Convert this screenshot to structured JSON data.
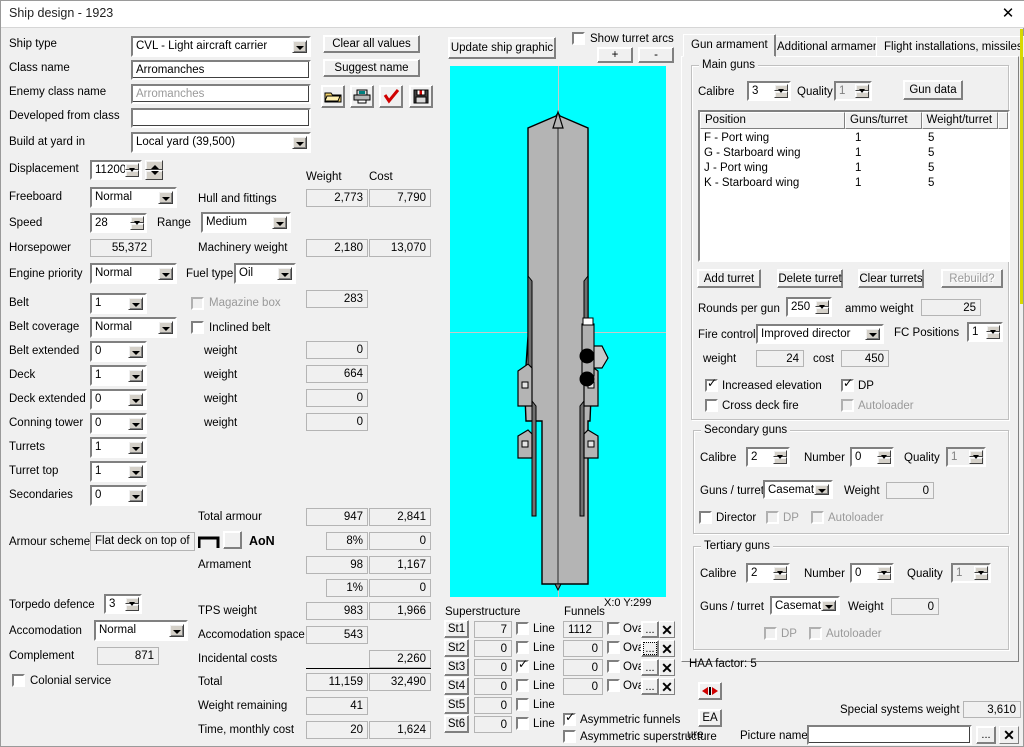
{
  "window": {
    "title": "Ship design - 1923",
    "close_label": "✕"
  },
  "left": {
    "ship_type_label": "Ship type",
    "ship_type_value": "CVL - Light aircraft carrier",
    "class_name_label": "Class name",
    "class_name_value": "Arromanches",
    "enemy_class_label": "Enemy class name",
    "enemy_class_value": "Arromanches",
    "developed_from_label": "Developed from class",
    "developed_from_value": "",
    "build_yard_label": "Build at yard in",
    "build_yard_value": "Local yard (39,500)",
    "displacement_label": "Displacement",
    "displacement_value": "11200",
    "freeboard_label": "Freeboard",
    "freeboard_value": "Normal",
    "speed_label": "Speed",
    "speed_value": "28",
    "range_label": "Range",
    "range_value": "Medium",
    "horsepower_label": "Horsepower",
    "horsepower_value": "55,372",
    "engine_priority_label": "Engine priority",
    "engine_priority_value": "Normal",
    "fuel_type_label": "Fuel type",
    "fuel_type_value": "Oil",
    "belt_label": "Belt",
    "belt_value": "1",
    "belt_coverage_label": "Belt coverage",
    "belt_coverage_value": "Normal",
    "belt_extended_label": "Belt extended",
    "belt_extended_value": "0",
    "deck_label": "Deck",
    "deck_value": "1",
    "deck_extended_label": "Deck extended",
    "deck_extended_value": "0",
    "conning_tower_label": "Conning tower",
    "conning_tower_value": "0",
    "turrets_label": "Turrets",
    "turrets_value": "1",
    "turret_top_label": "Turret top",
    "turret_top_value": "1",
    "secondaries_label": "Secondaries",
    "secondaries_value": "0",
    "armour_scheme_label": "Armour scheme",
    "armour_scheme_value": "Flat deck on top of",
    "aon_label": "AoN",
    "torpedo_defence_label": "Torpedo defence",
    "torpedo_defence_value": "3",
    "accomodation_label": "Accomodation",
    "accomodation_value": "Normal",
    "complement_label": "Complement",
    "complement_value": "871",
    "colonial_service_label": "Colonial service",
    "colonial_service_checked": false,
    "magazine_box_label": "Magazine box",
    "inclined_belt_label": "Inclined belt"
  },
  "weights": {
    "weight_header": "Weight",
    "cost_header": "Cost",
    "rows": [
      {
        "label": "Hull and fittings",
        "weight": "2,773",
        "cost": "7,790"
      },
      {
        "label": "Machinery weight",
        "weight": "2,180",
        "cost": "13,070"
      },
      {
        "label": "",
        "weight": "283",
        "cost": ""
      },
      {
        "label": "weight",
        "weight": "0",
        "cost": ""
      },
      {
        "label": "weight",
        "weight": "664",
        "cost": ""
      },
      {
        "label": "weight",
        "weight": "0",
        "cost": ""
      },
      {
        "label": "weight",
        "weight": "0",
        "cost": ""
      }
    ],
    "total_armour_label": "Total armour",
    "total_armour_weight": "947",
    "total_armour_cost": "2,841",
    "armour_pct": "8%",
    "armour_pct_cost": "0",
    "armament_label": "Armament",
    "armament_weight": "98",
    "armament_cost": "1,167",
    "armament_pct": "1%",
    "armament_pct_cost": "0",
    "tps_label": "TPS weight",
    "tps_weight": "983",
    "tps_cost": "1,966",
    "accom_space_label": "Accomodation space",
    "accom_space_value": "543",
    "incidental_label": "Incidental costs",
    "incidental_cost": "2,260",
    "total_label": "Total",
    "total_weight": "11,159",
    "total_cost": "32,490",
    "weight_remaining_label": "Weight remaining",
    "weight_remaining_value": "41",
    "time_cost_label": "Time, monthly cost",
    "time_value": "20",
    "monthly_cost": "1,624"
  },
  "toolbar": {
    "clear_all": "Clear all values",
    "suggest_name": "Suggest name",
    "update_graphic": "Update ship graphic",
    "show_turret_arcs": "Show turret arcs",
    "show_turret_arcs_checked": false,
    "plus": "+",
    "minus": "-",
    "open_icon": "open-folder-icon",
    "print_icon": "printer-icon",
    "check_icon": "red-check-icon",
    "save_icon": "floppy-save-icon"
  },
  "ship_graphic": {
    "coords": "X:0 Y:299"
  },
  "superstructure": {
    "title": "Superstructure",
    "line_label": "Line",
    "rows": [
      {
        "btn": "St1",
        "value": "7",
        "line": false
      },
      {
        "btn": "St2",
        "value": "0",
        "line": false
      },
      {
        "btn": "St3",
        "value": "0",
        "line": true
      },
      {
        "btn": "St4",
        "value": "0",
        "line": false
      },
      {
        "btn": "St5",
        "value": "0",
        "line": false
      },
      {
        "btn": "St6",
        "value": "0",
        "line": false
      }
    ]
  },
  "funnels": {
    "title": "Funnels",
    "oval_label": "Oval",
    "dots_label": "...",
    "x_label": "✕",
    "rows": [
      {
        "value": "1112",
        "oval": false
      },
      {
        "value": "0",
        "oval": false
      },
      {
        "value": "0",
        "oval": false
      },
      {
        "value": "0",
        "oval": false
      }
    ],
    "asym_funnels_label": "Asymmetric funnels",
    "asym_funnels_checked": true,
    "asym_super_label": "Asymmetric superstructure",
    "asym_super_checked": false
  },
  "right": {
    "tabs": [
      {
        "label": "Gun armament",
        "active": true
      },
      {
        "label": "Additional armament",
        "active": false
      },
      {
        "label": "Flight installations, missiles",
        "active": false
      }
    ],
    "main_guns": {
      "title": "Main guns",
      "calibre_label": "Calibre",
      "calibre_value": "3",
      "quality_label": "Quality",
      "quality_value": "1",
      "gun_data_btn": "Gun data",
      "columns": [
        "Position",
        "Guns/turret",
        "Weight/turret"
      ],
      "rows": [
        {
          "position": "F - Port wing",
          "guns": "1",
          "weight": "5"
        },
        {
          "position": "G - Starboard wing",
          "guns": "1",
          "weight": "5"
        },
        {
          "position": "J - Port wing",
          "guns": "1",
          "weight": "5"
        },
        {
          "position": "K - Starboard wing",
          "guns": "1",
          "weight": "5"
        }
      ],
      "add_turret": "Add turret",
      "delete_turret": "Delete turret",
      "clear_turrets": "Clear turrets",
      "rebuild": "Rebuild?",
      "rounds_label": "Rounds per gun",
      "rounds_value": "250",
      "ammo_weight_label": "ammo weight",
      "ammo_weight_value": "25",
      "fire_control_label": "Fire control",
      "fire_control_value": "Improved director",
      "fc_positions_label": "FC Positions",
      "fc_positions_value": "1",
      "weight_label": "weight",
      "weight_value": "24",
      "cost_label": "cost",
      "cost_value": "450",
      "increased_elevation_label": "Increased elevation",
      "increased_elevation_checked": true,
      "dp_label": "DP",
      "dp_checked": true,
      "cross_deck_label": "Cross deck fire",
      "cross_deck_checked": false,
      "autoloader_label": "Autoloader",
      "autoloader_checked": false
    },
    "secondary_guns": {
      "title": "Secondary guns",
      "calibre_label": "Calibre",
      "calibre_value": "2",
      "number_label": "Number",
      "number_value": "0",
      "quality_label": "Quality",
      "quality_value": "1",
      "guns_turret_label": "Guns / turret",
      "guns_turret_value": "Casemate:",
      "weight_label": "Weight",
      "weight_value": "0",
      "director_label": "Director",
      "director_checked": false,
      "dp_label": "DP",
      "dp_checked": false,
      "autoloader_label": "Autoloader",
      "autoloader_checked": false
    },
    "tertiary_guns": {
      "title": "Tertiary guns",
      "calibre_label": "Calibre",
      "calibre_value": "2",
      "number_label": "Number",
      "number_value": "0",
      "quality_label": "Quality",
      "quality_value": "1",
      "guns_turret_label": "Guns / turret",
      "guns_turret_value": "Casemate:",
      "weight_label": "Weight",
      "weight_value": "0",
      "dp_label": "DP",
      "dp_checked": false,
      "autoloader_label": "Autoloader",
      "autoloader_checked": false
    },
    "haa_factor": "HAA factor: 5",
    "flip_icon": "left-right-arrows-icon",
    "ea_btn": "EA",
    "special_systems_label": "Special systems weight",
    "special_systems_value": "3,610",
    "picture_name_label": "Picture name",
    "picture_name_value": "",
    "picture_browse": "...",
    "picture_clear": "✕",
    "picture_word": "ure"
  }
}
